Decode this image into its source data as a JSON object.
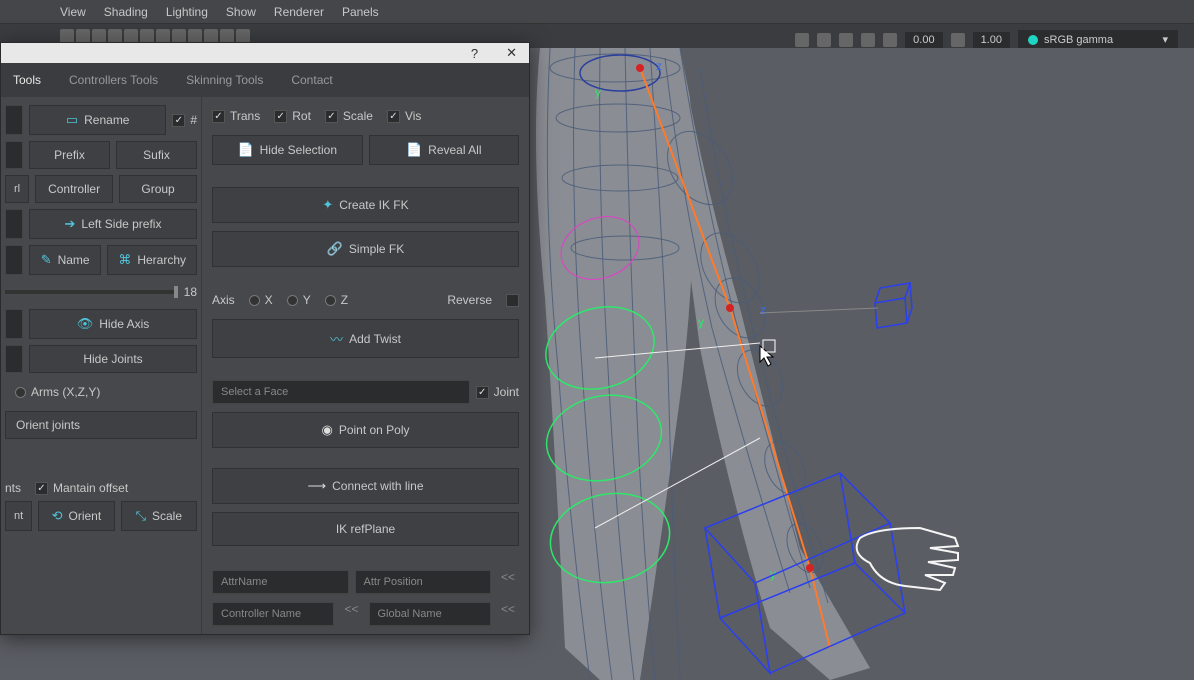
{
  "menubar": {
    "items": [
      "View",
      "Shading",
      "Lighting",
      "Show",
      "Renderer",
      "Panels"
    ]
  },
  "right_ctrls": {
    "val1": "0.00",
    "val2": "1.00",
    "colorspace": "sRGB gamma"
  },
  "tool_window": {
    "titlebar": {
      "help": "?",
      "close": "✕"
    },
    "tabs": [
      "Tools",
      "Controllers Tools",
      "Skinning Tools",
      "Contact"
    ],
    "left": {
      "rename": "Rename",
      "hash": "#",
      "prefix": "Prefix",
      "sufix": "Sufix",
      "rl": "rl",
      "controller": "Controller",
      "group": "Group",
      "left_side": "Left Side prefix",
      "name": "Name",
      "herarchy": "Herarchy",
      "slider_val": "18",
      "hide_axis": "Hide Axis",
      "hide_joints": "Hide Joints",
      "arms": "Arms (X,Z,Y)",
      "orient_joints": "Orient joints",
      "mantain_offset": "Mantain offset",
      "nts": "nts",
      "nt": "nt",
      "orient": "Orient",
      "scale": "Scale"
    },
    "right": {
      "trans": "Trans",
      "rot": "Rot",
      "scale_chk": "Scale",
      "vis": "Vis",
      "hide_selection": "Hide Selection",
      "reveal_all": "Reveal All",
      "create_ikfk": "Create IK FK",
      "simple_fk": "Simple FK",
      "axis_label": "Axis",
      "x": "X",
      "y": "Y",
      "z": "Z",
      "reverse": "Reverse",
      "add_twist": "Add Twist",
      "select_face": "Select a Face",
      "joint": "Joint",
      "point_on_poly": "Point on Poly",
      "connect_line": "Connect with line",
      "ik_refplane": "IK refPlane",
      "attr_name": "AttrName",
      "attr_pos": "Attr Position",
      "ctrl_name": "Controller Name",
      "global_name": "Global Name"
    }
  }
}
